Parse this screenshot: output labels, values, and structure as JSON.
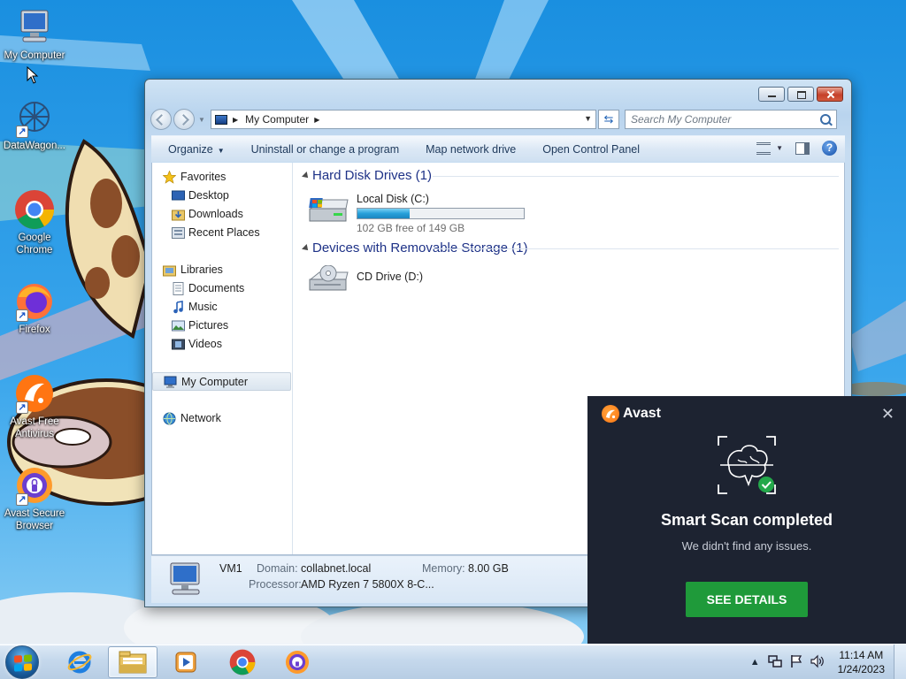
{
  "desktop": {
    "icons": [
      {
        "label_1": "My Computer",
        "label_2": ""
      },
      {
        "label_1": "DataWagon...",
        "label_2": ""
      },
      {
        "label_1": "Google",
        "label_2": "Chrome"
      },
      {
        "label_1": "Firefox",
        "label_2": ""
      },
      {
        "label_1": "Avast Free",
        "label_2": "Antivirus"
      },
      {
        "label_1": "Avast Secure",
        "label_2": "Browser"
      }
    ]
  },
  "explorer": {
    "address": "My Computer",
    "search_placeholder": "Search My Computer",
    "commands": [
      "Organize",
      "Uninstall or change a program",
      "Map network drive",
      "Open Control Panel"
    ],
    "nav": {
      "favorites": "Favorites",
      "favorites_items": [
        "Desktop",
        "Downloads",
        "Recent Places"
      ],
      "libraries": "Libraries",
      "libraries_items": [
        "Documents",
        "Music",
        "Pictures",
        "Videos"
      ],
      "computer": "My Computer",
      "network": "Network"
    },
    "groups": {
      "hdd_title": "Hard Disk Drives (1)",
      "removable_title": "Devices with Removable Storage (1)"
    },
    "drives": {
      "c_name": "Local Disk (C:)",
      "c_free": "102 GB free of 149 GB",
      "c_used_fraction": 0.315,
      "d_name": "CD Drive (D:)"
    },
    "details": {
      "computer_name": "VM1",
      "domain_label": "Domain:",
      "domain_value": "collabnet.local",
      "memory_label": "Memory:",
      "memory_value": "8.00 GB",
      "processor_label": "Processor:",
      "processor_value": "AMD Ryzen 7 5800X 8-C..."
    }
  },
  "avast_popup": {
    "brand": "Avast",
    "headline": "Smart Scan completed",
    "message": "We didn't find any issues.",
    "button": "SEE DETAILS",
    "accent_color": "#1f9a3a",
    "background_color": "#1d2331"
  },
  "taskbar": {
    "apps": [
      "internet-explorer",
      "windows-explorer",
      "media-player",
      "google-chrome",
      "avast-secure-browser"
    ],
    "time": "11:14 AM",
    "date": "1/24/2023"
  }
}
